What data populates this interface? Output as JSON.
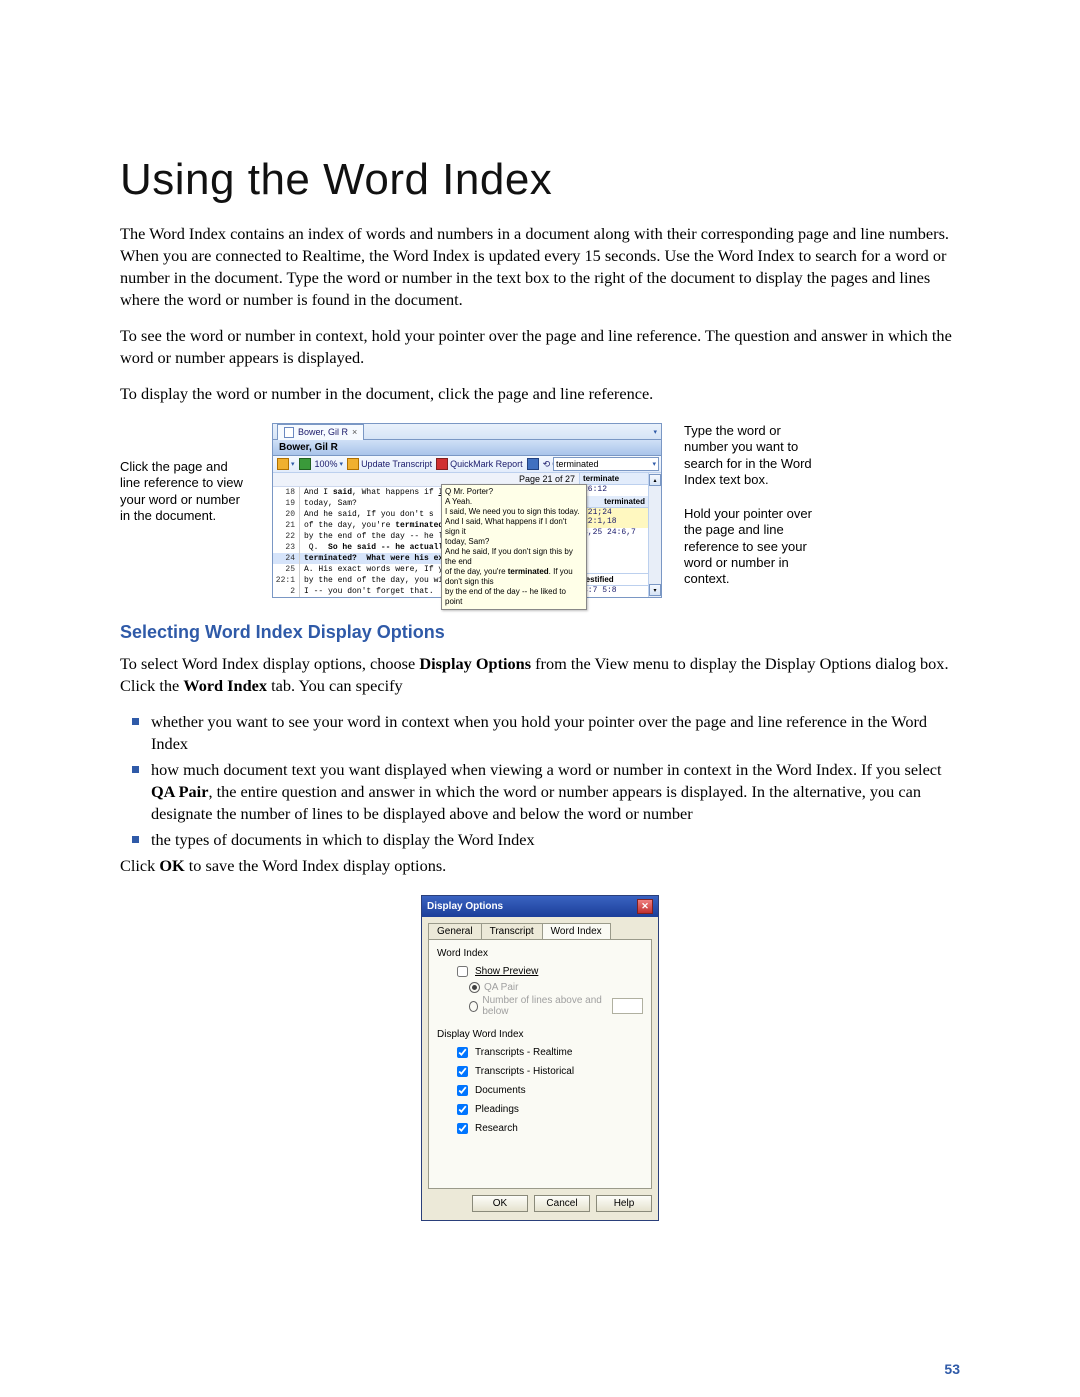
{
  "title": "Using the Word Index",
  "para1": "The Word Index contains an index of words and numbers in a document along with their corresponding page and line numbers. When you are connected to Realtime, the Word Index is updated every 15 seconds. Use the Word Index to search for a word or number in the document. Type the word or number in the text box to the right of the document to display the pages and lines where the word or number is found in the document.",
  "para2": "To see the word or number in context, hold your pointer over the page and line reference. The question and answer in which the word or number appears is displayed.",
  "para3": "To display the word or number in the document, click the page and line reference.",
  "callout_left": "Click the page and line reference to view your word or number in the document.",
  "callout_right1": "Type the word or number you want to search for in the Word Index text box.",
  "callout_right2": "Hold your pointer over the page and line reference to see your word or number in context.",
  "app": {
    "tab_name": "Bower, Gil R",
    "zoom": "100%",
    "tools": {
      "update": "Update Transcript",
      "quickmark": "QuickMark Report",
      "connect": "Connect"
    },
    "search_value": "terminated",
    "page_header": "Page 21 of 27",
    "lines": [
      {
        "no": "18",
        "text": "And I said, What happens if I don't sign it"
      },
      {
        "no": "19",
        "text": "today, Sam?"
      },
      {
        "no": "20",
        "text": "    And he said, If you don't s"
      },
      {
        "no": "21",
        "text": "of the day, you're terminated.  If yo"
      },
      {
        "no": "22",
        "text": "by the end of the day -- he liked to"
      },
      {
        "no": "23",
        "text": " Q.  So he said -- he actually sa"
      },
      {
        "no": "24",
        "text": "terminated?  What were his exact word",
        "hl": true
      },
      {
        "no": "25",
        "text": " A.  His exact words were, If yo"
      },
      {
        "no": "22:1",
        "text": "by the end of the day, you will be terminated."
      },
      {
        "no": "2",
        "text": "I -- you don't forget that."
      }
    ],
    "tooltip": {
      "l1": "Q  Mr. Porter?",
      "l2": "A  Yeah.",
      "l3": "  I said, We need you to sign this today.",
      "l4": "  And I said, What happens if I don't sign it",
      "l5": "today, Sam?",
      "l6": "  And he said, If you don't sign this by the end",
      "l7": "of the day, you're terminated. If you don't sign this",
      "l8": "by the end of the day -- he liked to point"
    },
    "index": {
      "h1": "terminate",
      "r1": "26:12",
      "h2": "terminated",
      "r2a": ";21;24 22:1,18",
      "r2b": "3,25 24:6,7",
      "h3": "testified",
      "r3": "3:7 5:8"
    }
  },
  "h2": "Selecting Word Index Display Options",
  "p4a": "To select Word Index display options, choose ",
  "p4b": "Display Options",
  "p4c": " from the View menu to display the Display Options dialog box. Click the ",
  "p4d": "Word Index",
  "p4e": " tab. You can specify",
  "b1": "whether you want to see your word in context when you hold your pointer over the page and line reference in the Word Index",
  "b2a": "how much document text you want displayed when viewing a word or number in context in the Word Index. If you select ",
  "b2b": "QA Pair",
  "b2c": ", the entire question and answer in which the word or number appears is displayed. In the alternative, you can designate the number of lines to be displayed above and below the word or number",
  "b3": "the types of documents in which to display the Word Index",
  "p5a": "Click ",
  "p5b": "OK",
  "p5c": " to save the Word Index display options.",
  "dlg": {
    "title": "Display Options",
    "tabs": {
      "general": "General",
      "transcript": "Transcript",
      "word_index": "Word Index"
    },
    "group1": "Word Index",
    "show_preview": "Show Preview",
    "qa_pair": "QA Pair",
    "num_lines": "Number of lines above and below",
    "group2": "Display Word Index",
    "opts": {
      "a": "Transcripts - Realtime",
      "b": "Transcripts - Historical",
      "c": "Documents",
      "d": "Pleadings",
      "e": "Research"
    },
    "btns": {
      "ok": "OK",
      "cancel": "Cancel",
      "help": "Help"
    }
  },
  "page_number": "53"
}
